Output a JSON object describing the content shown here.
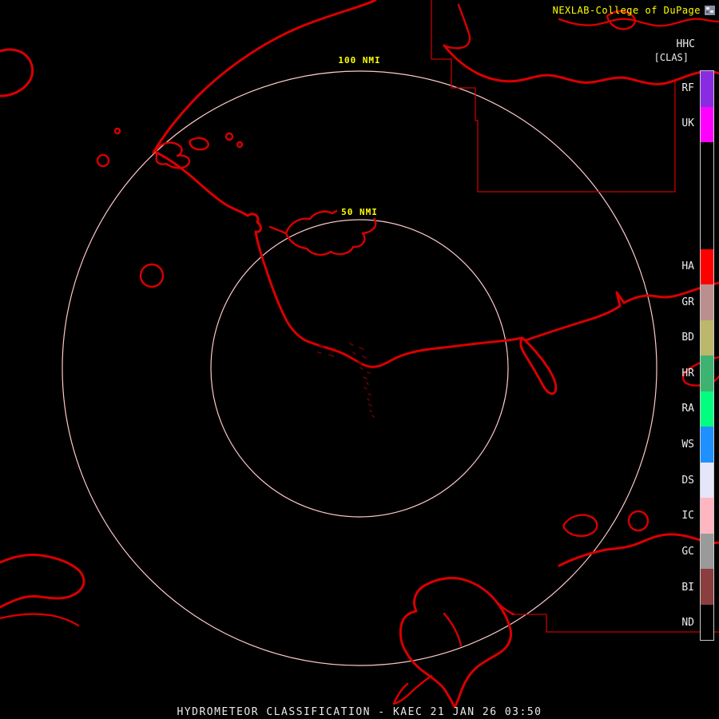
{
  "header": {
    "brand": "NEXLAB-College of DuPage",
    "logo_icon": "college-of-dupage-logo"
  },
  "legend": {
    "title": "HHC",
    "mode": "[CLAS]",
    "segments": [
      {
        "label": "RF",
        "color": "#8a2be2"
      },
      {
        "label": "UK",
        "color": "#ff00ff"
      },
      {
        "label": "",
        "color": "#000000"
      },
      {
        "label": "",
        "color": "#000000"
      },
      {
        "label": "",
        "color": "#000000"
      },
      {
        "label": "HA",
        "color": "#ff0000"
      },
      {
        "label": "GR",
        "color": "#bc8f8f"
      },
      {
        "label": "BD",
        "color": "#bdb76b"
      },
      {
        "label": "HR",
        "color": "#3cb371"
      },
      {
        "label": "RA",
        "color": "#00ff7f"
      },
      {
        "label": "WS",
        "color": "#1e90ff"
      },
      {
        "label": "DS",
        "color": "#e6e6fa"
      },
      {
        "label": "IC",
        "color": "#ffb6c1"
      },
      {
        "label": "GC",
        "color": "#9a9a9a"
      },
      {
        "label": "BI",
        "color": "#8b3e3e"
      },
      {
        "label": "ND",
        "color": "#000000"
      }
    ]
  },
  "rings": {
    "outer_label": "100 NMI",
    "inner_label": "50 NMI"
  },
  "footer": {
    "status": "HYDROMETEOR CLASSIFICATION - KAEC 21 JAN 26 03:50"
  },
  "colors": {
    "background": "#000000",
    "coastline": "#d90000",
    "political_border": "#c40000",
    "range_ring": "#ffc9c9",
    "range_label": "#ffff00",
    "brand_text": "#ffff00",
    "legend_text": "#ededed",
    "status_text": "#e9e9e9",
    "status_rule": "#2727cf"
  }
}
